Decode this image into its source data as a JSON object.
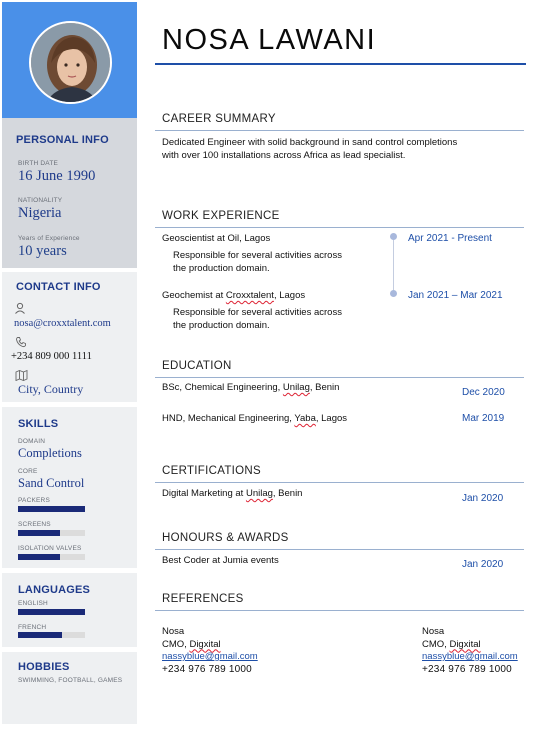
{
  "name": "NOSA LAWANI",
  "sidebar": {
    "personal_info": {
      "title": "PERSONAL INFO",
      "birth_label": "BIRTH DATE",
      "birth_value": "16 June 1990",
      "nationality_label": "NATIONALITY",
      "nationality_value": "Nigeria",
      "experience_label": "Years of Experience",
      "experience_value": "10 years"
    },
    "contact_info": {
      "title": "CONTACT INFO",
      "email": "nosa@croxxtalent.com",
      "phone": "+234 809 000 1111",
      "location": "City, Country",
      "icons": [
        "user-at-icon",
        "phone-icon",
        "map-icon"
      ]
    },
    "skills": {
      "title": "SKILLS",
      "domain_label": "DOMAIN",
      "domain_value": "Completions",
      "core_label": "CORE",
      "core_value": "Sand Control",
      "bars": [
        {
          "label": "PACKERS",
          "level": 1.0
        },
        {
          "label": "SCREENS",
          "level": 0.62
        },
        {
          "label": "ISOLATION VALVES",
          "level": 0.62
        }
      ]
    },
    "languages": {
      "title": "LANGUAGES",
      "items": [
        {
          "label": "ENGLISH",
          "level": 1.0
        },
        {
          "label": "FRENCH",
          "level": 0.65
        }
      ]
    },
    "hobbies": {
      "title": "HOBBIES",
      "text": "SWIMMING, FOOTBALL, GAMES"
    }
  },
  "career_summary": {
    "title": "CAREER SUMMARY",
    "text": "Dedicated Engineer with solid background in sand control completions with over 100 installations across Africa as lead specialist."
  },
  "work_experience": {
    "title": "WORK EXPERIENCE",
    "items": [
      {
        "role": "Geoscientist at Oil, Lagos",
        "desc": "Responsible for several activities across the production domain.",
        "dates": "Apr 2021 - Present"
      },
      {
        "role_prefix": "Geochemist at ",
        "company": "Croxxtalent",
        "role_suffix": ", Lagos",
        "desc": "Responsible for several activities across the production domain.",
        "dates": "Jan 2021 – Mar 2021"
      }
    ]
  },
  "education": {
    "title": "EDUCATION",
    "items": [
      {
        "pre": "BSc, Chemical Engineering, ",
        "school": "Unilag",
        "post": ", Benin",
        "date": "Dec 2020"
      },
      {
        "pre": "HND, Mechanical Engineering, ",
        "school": "Yaba",
        "post": ", Lagos",
        "date": "Mar 2019"
      }
    ]
  },
  "certifications": {
    "title": "CERTIFICATIONS",
    "pre": "Digital Marketing at ",
    "school": "Unilag",
    "post": ", Benin",
    "date": "Jan 2020"
  },
  "honours": {
    "title": "HONOURS & AWARDS",
    "text": "Best Coder at Jumia events",
    "date": "Jan 2020"
  },
  "references": {
    "title": "REFERENCES",
    "items": [
      {
        "name": "Nosa",
        "role_pre": "CMO, ",
        "company": "Digxital",
        "email": "nassyblue@gmail.com",
        "phone": "+234 976 789 1000"
      },
      {
        "name": "Nosa",
        "role_pre": "CMO, ",
        "company": "Digxital",
        "email": "nassyblue@gmail.com",
        "phone": "+234 976 789 1000"
      }
    ]
  },
  "colors": {
    "accent_blue": "#4a90e8",
    "heading_navy": "#1e3a8a",
    "panel_gray": "#d5d8dd",
    "bar_fill": "#1a2a78"
  }
}
